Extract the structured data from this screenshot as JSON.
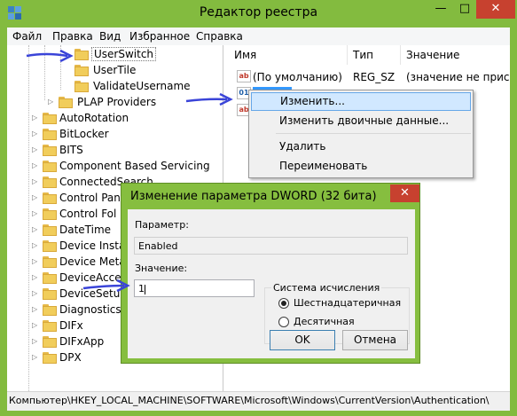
{
  "window": {
    "title": "Редактор реестра",
    "minimize_glyph": "—",
    "maximize_glyph": "□",
    "close_glyph": "✕"
  },
  "menu": [
    "Файл",
    "Правка",
    "Вид",
    "Избранное",
    "Справка"
  ],
  "tree": {
    "items": [
      {
        "label": "UserSwitch",
        "selected": true
      },
      {
        "label": "UserTile"
      },
      {
        "label": "ValidateUsername"
      },
      {
        "label": "PLAP Providers"
      },
      {
        "label": "AutoRotation"
      },
      {
        "label": "BitLocker"
      },
      {
        "label": "BITS"
      },
      {
        "label": "Component Based Servicing"
      },
      {
        "label": "ConnectedSearch"
      },
      {
        "label": "Control Pane"
      },
      {
        "label": "Control Fol"
      },
      {
        "label": "DateTime"
      },
      {
        "label": "Device Instal"
      },
      {
        "label": "Device Meta"
      },
      {
        "label": "DeviceAcces"
      },
      {
        "label": "DeviceSetup"
      },
      {
        "label": "Diagnostics"
      },
      {
        "label": "DIFx"
      },
      {
        "label": "DIFxApp"
      },
      {
        "label": "DPX"
      }
    ]
  },
  "values_pane": {
    "columns": [
      "Имя",
      "Тип",
      "Значение"
    ],
    "rows": [
      {
        "icon": "ab",
        "name": "(По умолчанию)",
        "type": "REG_SZ",
        "data": "(значение не присвое"
      }
    ]
  },
  "context_menu": {
    "items": [
      "Изменить...",
      "Изменить двоичные данные...",
      "Удалить",
      "Переименовать"
    ]
  },
  "dialog": {
    "title": "Изменение параметра DWORD (32 бита)",
    "close_glyph": "✕",
    "param_label": "Параметр:",
    "param_value": "Enabled",
    "value_label": "Значение:",
    "value_value": "1",
    "radix_legend": "Система исчисления",
    "radix_hex": "Шестнадцатеричная",
    "radix_dec": "Десятичная",
    "radix_selected": "hex",
    "ok": "OK",
    "cancel": "Отмена"
  },
  "statusbar": {
    "path": "Компьютер\\HKEY_LOCAL_MACHINE\\SOFTWARE\\Microsoft\\Windows\\CurrentVersion\\Authentication\\"
  },
  "annotation_color": "#3a44d8"
}
